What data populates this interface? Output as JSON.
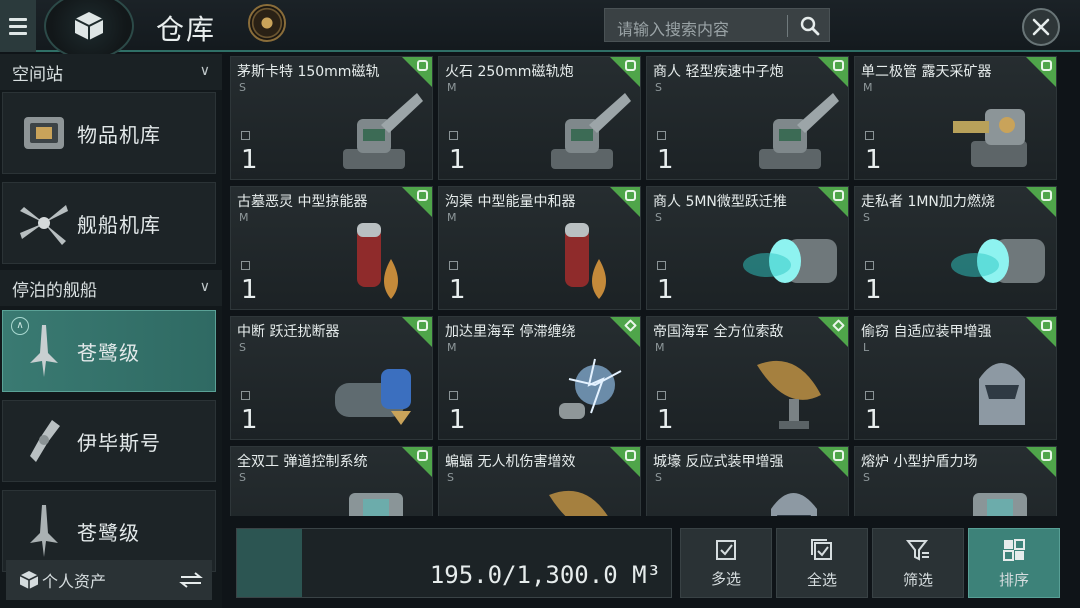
{
  "header": {
    "title": "仓库",
    "search_placeholder": "请输入搜索内容"
  },
  "sidebar": {
    "section_station": "空间站",
    "station_items": [
      {
        "label": "物品机库",
        "icon": "cargo-container-icon"
      },
      {
        "label": "舰船机库",
        "icon": "ship-hangar-icon"
      }
    ],
    "section_docked": "停泊的舰船",
    "ships": [
      {
        "label": "苍鹭级",
        "active": true
      },
      {
        "label": "伊毕斯号",
        "active": false
      },
      {
        "label": "苍鹭级",
        "active": false
      }
    ],
    "personal_assets": "个人资产"
  },
  "items": [
    {
      "name": "茅斯卡特 150mm磁轨",
      "size": "S",
      "qty": "1",
      "tag": "square",
      "art": "turret"
    },
    {
      "name": "火石 250mm磁轨炮",
      "size": "M",
      "qty": "1",
      "tag": "square",
      "art": "turret"
    },
    {
      "name": "商人 轻型疾速中子炮",
      "size": "S",
      "qty": "1",
      "tag": "square",
      "art": "turret"
    },
    {
      "name": "单二极管 露天采矿器",
      "size": "M",
      "qty": "1",
      "tag": "square",
      "art": "miner"
    },
    {
      "name": "古墓恶灵 中型掠能器",
      "size": "M",
      "qty": "1",
      "tag": "square",
      "art": "capacitor"
    },
    {
      "name": "沟渠 中型能量中和器",
      "size": "M",
      "qty": "1",
      "tag": "square",
      "art": "capacitor"
    },
    {
      "name": "商人 5MN微型跃迁推",
      "size": "S",
      "qty": "1",
      "tag": "square",
      "art": "thruster"
    },
    {
      "name": "走私者 1MN加力燃烧",
      "size": "S",
      "qty": "1",
      "tag": "square",
      "art": "thruster"
    },
    {
      "name": "中断 跃迁扰断器",
      "size": "S",
      "qty": "1",
      "tag": "square",
      "art": "disruptor"
    },
    {
      "name": "加达里海军 停滞缠绕",
      "size": "M",
      "qty": "1",
      "tag": "diamond",
      "art": "web"
    },
    {
      "name": "帝国海军 全方位索敌",
      "size": "M",
      "qty": "1",
      "tag": "diamond",
      "art": "dish"
    },
    {
      "name": "偷窃 自适应装甲增强",
      "size": "L",
      "qty": "1",
      "tag": "square",
      "art": "helmet"
    },
    {
      "name": "全双工 弹道控制系统",
      "size": "S",
      "qty": "",
      "tag": "square",
      "art": "module"
    },
    {
      "name": "蝙蝠 无人机伤害增效",
      "size": "S",
      "qty": "",
      "tag": "square",
      "art": "dish"
    },
    {
      "name": "城壕 反应式装甲增强",
      "size": "S",
      "qty": "",
      "tag": "square",
      "art": "helmet"
    },
    {
      "name": "熔炉 小型护盾力场",
      "size": "S",
      "qty": "",
      "tag": "square",
      "art": "module"
    }
  ],
  "capacity": {
    "text": "195.0/1,300.0 M³",
    "used": 195.0,
    "total": 1300.0
  },
  "actions": [
    {
      "label": "多选",
      "icon": "multi-select-icon",
      "active": false
    },
    {
      "label": "全选",
      "icon": "select-all-icon",
      "active": false
    },
    {
      "label": "筛选",
      "icon": "filter-icon",
      "active": false
    },
    {
      "label": "排序",
      "icon": "sort-icon",
      "active": true
    }
  ],
  "colors": {
    "accent": "#3d8279",
    "tag_green": "#4fa54a",
    "background": "#0f1418"
  }
}
